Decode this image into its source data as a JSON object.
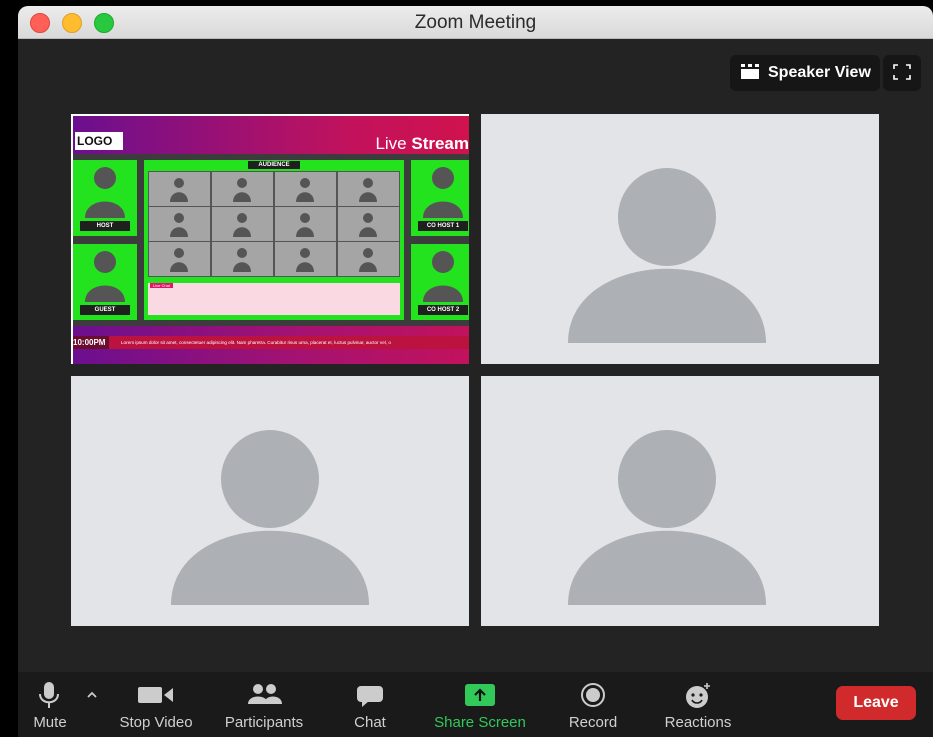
{
  "window": {
    "title": "Zoom Meeting"
  },
  "top_controls": {
    "speaker_view_label": "Speaker View",
    "speaker_view_icon": "grid-icon",
    "fullscreen_icon": "fullscreen-icon"
  },
  "stream_tile": {
    "logo": "LOGO",
    "live_prefix": "Live",
    "live_bold": "Stream",
    "audience_label": "AUDIENCE",
    "host_label": "HOST",
    "guest_label": "GUEST",
    "cohost1_label": "CO HOST 1",
    "cohost2_label": "CO HOST 2",
    "chat_tag": "Live Chat",
    "time": "10:00PM",
    "ticker_text": "Lorem ipsum dolor sit amet, consectetuer adipiscing elit. Nam pharetra. Curabitur risus urna, placerat et, luctus pulvinar, auctor vel, o"
  },
  "toolbar": {
    "mute": "Mute",
    "stop_video": "Stop Video",
    "participants": "Participants",
    "chat": "Chat",
    "share_screen": "Share Screen",
    "record": "Record",
    "reactions": "Reactions",
    "leave": "Leave"
  },
  "colors": {
    "share_green": "#31c95a",
    "leave_red": "#d12a2c",
    "green_screen": "#22e31d"
  }
}
